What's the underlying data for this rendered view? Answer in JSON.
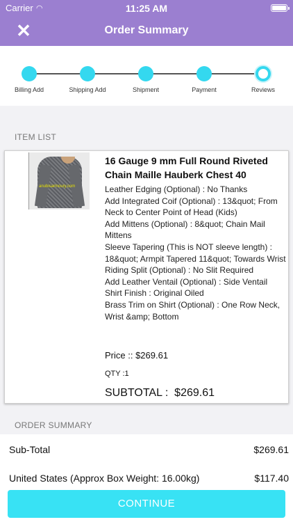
{
  "status_bar": {
    "carrier": "Carrier",
    "time": "11:25 AM"
  },
  "nav": {
    "title": "Order Summary",
    "close_icon": "close-icon"
  },
  "steps": [
    {
      "label": "Billing Add",
      "state": "done"
    },
    {
      "label": "Shipping Add",
      "state": "done"
    },
    {
      "label": "Shipment",
      "state": "done"
    },
    {
      "label": "Payment",
      "state": "done"
    },
    {
      "label": "Reviews",
      "state": "current"
    }
  ],
  "item_list_label": "ITEM LIST",
  "item": {
    "title": "16 Gauge 9 mm Full Round Riveted Chain Maille Hauberk Chest 40",
    "image_watermark": "anubisarmoury.com",
    "options": [
      "Leather Edging (Optional) : No Thanks",
      "Add Integrated Coif (Optional) : 13&quot; From Neck to Center Point of Head (Kids)",
      "Add Mittens (Optional) : 8&quot; Chain Mail Mittens",
      "Sleeve Tapering (This is NOT sleeve length) : 18&quot; Armpit Tapered 11&quot; Towards Wrist",
      "Riding Split (Optional) : No Slit Required",
      "Add Leather Ventail (Optional) : Side Ventail",
      "Shirt Finish : Original Oiled",
      "Brass Trim on Shirt (Optional) : One Row Neck, Wrist &amp; Bottom"
    ],
    "price": "Price :: $269.61",
    "qty": "QTY :1",
    "subtotal_label": "SUBTOTAL :",
    "subtotal_value": "$269.61"
  },
  "order_summary_label": "ORDER SUMMARY",
  "summary": {
    "subtotal_label": "Sub-Total",
    "subtotal_value": "$269.61",
    "shipping_label": "United States  (Approx Box Weight: 16.00kg)",
    "shipping_value": "$117.40"
  },
  "continue_label": "CONTINUE",
  "colors": {
    "header": "#9b7fd0",
    "accent": "#34d8ef",
    "button": "#38e2f4"
  }
}
